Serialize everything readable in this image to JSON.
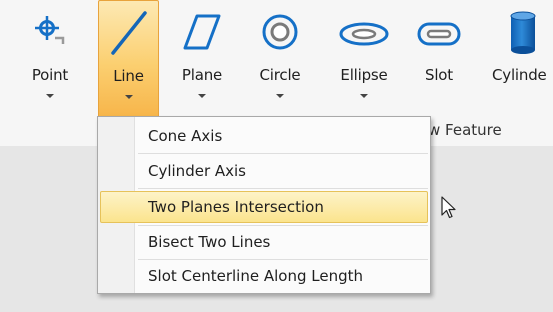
{
  "ribbon": {
    "tools": [
      {
        "label": "Point",
        "icon": "point-icon"
      },
      {
        "label": "Line",
        "icon": "line-icon",
        "active": true
      },
      {
        "label": "Plane",
        "icon": "plane-icon"
      },
      {
        "label": "Circle",
        "icon": "circle-icon"
      },
      {
        "label": "Ellipse",
        "icon": "ellipse-icon"
      },
      {
        "label": "Slot",
        "icon": "slot-icon"
      },
      {
        "label": "Cylinde",
        "icon": "cylinder-icon"
      }
    ],
    "group_label": "w Feature"
  },
  "dropdown": {
    "items": [
      {
        "label": "Cone Axis"
      },
      {
        "label": "Cylinder Axis"
      },
      {
        "label": "Two Planes Intersection",
        "highlighted": true
      },
      {
        "label": "Bisect Two Lines"
      },
      {
        "label": "Slot Centerline Along Length"
      }
    ]
  },
  "colors": {
    "active_tool_top": "#fde9b3",
    "active_tool_bottom": "#f7b54a",
    "icon_blue": "#1570c7",
    "menu_highlight": "#fbe48d"
  }
}
